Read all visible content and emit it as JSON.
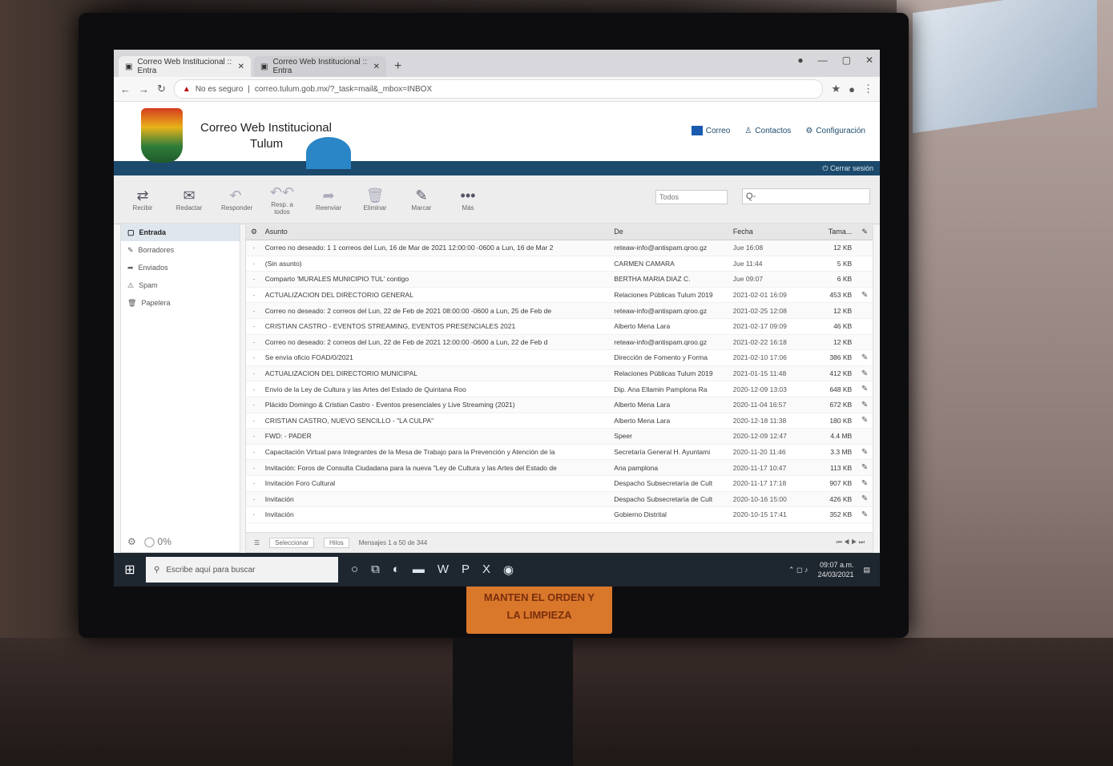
{
  "browser": {
    "tabs": [
      {
        "label": "Correo Web Institucional :: Entra"
      },
      {
        "label": "Correo Web Institucional :: Entra"
      }
    ],
    "new_tab": "+",
    "address_warning": "No es seguro",
    "url": "correo.tulum.gob.mx/?_task=mail&_mbox=INBOX"
  },
  "app": {
    "title_line1": "Correo Web Institucional",
    "title_line2": "Tulum",
    "nav": [
      {
        "label": "Correo"
      },
      {
        "label": "Contactos"
      },
      {
        "label": "Configuración"
      }
    ],
    "logout": "Cerrar sesión"
  },
  "toolbar": {
    "filter_placeholder": "Todos",
    "search_placeholder": "Q-",
    "buttons": [
      {
        "icon": "⇄",
        "label": "Recibir"
      },
      {
        "icon": "✉",
        "label": "Redactar"
      },
      {
        "icon": "↶",
        "label": "Responder"
      },
      {
        "icon": "↶↶",
        "label": "Resp. a todos"
      },
      {
        "icon": "➦",
        "label": "Reenviar"
      },
      {
        "icon": "🗑",
        "label": "Eliminar"
      },
      {
        "icon": "✎",
        "label": "Marcar"
      },
      {
        "icon": "•••",
        "label": "Más"
      }
    ]
  },
  "folders": [
    {
      "icon": "▢",
      "label": "Entrada"
    },
    {
      "icon": "✎",
      "label": "Borradores"
    },
    {
      "icon": "➦",
      "label": "Enviados"
    },
    {
      "icon": "⚠",
      "label": "Spam"
    },
    {
      "icon": "🗑",
      "label": "Papelera"
    }
  ],
  "sidebar_footer": {
    "quota": "0%"
  },
  "columns": {
    "subject": "Asunto",
    "from": "De",
    "date": "Fecha",
    "size": "Tama..."
  },
  "messages": [
    {
      "subject": "Correo no deseado: 1 1 correos del Lun, 16 de Mar de 2021 12:00:00 -0600 a Lun, 16 de Mar 2",
      "from": "reteaw-info@antispam.qroo.gz",
      "date": "Jue 16:08",
      "size": "12 KB",
      "clip": ""
    },
    {
      "subject": "(Sin asunto)",
      "from": "CARMEN CAMARA",
      "date": "Jue 11:44",
      "size": "5 KB",
      "clip": ""
    },
    {
      "subject": "Comparto 'MURALES MUNICIPIO TUL' contigo",
      "from": "BERTHA MARIA DIAZ C.",
      "date": "Jue 09:07",
      "size": "6 KB",
      "clip": ""
    },
    {
      "subject": "ACTUALIZACION DEL DIRECTORIO GENERAL",
      "from": "Relaciones Públicas Tulum 2019",
      "date": "2021-02-01 16:09",
      "size": "453 KB",
      "clip": "✎"
    },
    {
      "subject": "Correo no deseado: 2 correos del Lun, 22 de Feb de 2021 08:00:00 -0600 a Lun, 25 de Feb de",
      "from": "reteaw-info@antispam.qroo.gz",
      "date": "2021-02-25 12:08",
      "size": "12 KB",
      "clip": ""
    },
    {
      "subject": "CRISTIAN CASTRO - EVENTOS STREAMING, EVENTOS PRESENCIALES 2021",
      "from": "Alberto Mena Lara",
      "date": "2021-02-17 09:09",
      "size": "46 KB",
      "clip": ""
    },
    {
      "subject": "Correo no deseado: 2 correos del Lun, 22 de Feb de 2021 12:00:00 -0600 a Lun, 22 de Feb d",
      "from": "reteaw-info@antispam.qroo.gz",
      "date": "2021-02-22 16:18",
      "size": "12 KB",
      "clip": ""
    },
    {
      "subject": "Se envía oficio FOAD/0/2021",
      "from": "Dirección de Fomento y Forma",
      "date": "2021-02-10 17:06",
      "size": "386 KB",
      "clip": "✎"
    },
    {
      "subject": "ACTUALIZACION DEL DIRECTORIO MUNICIPAL",
      "from": "Relaciones Públicas Tulum 2019",
      "date": "2021-01-15 11:48",
      "size": "412 KB",
      "clip": "✎"
    },
    {
      "subject": "Envío de la Ley de Cultura y las Artes del Estado de Quintana Roo",
      "from": "Dip. Ana Ellamin Pamplona Ra",
      "date": "2020-12-09 13:03",
      "size": "648 KB",
      "clip": "✎"
    },
    {
      "subject": "Plácido Domingo & Cristian Castro - Eventos presenciales y Live Streaming (2021)",
      "from": "Alberto Mena Lara",
      "date": "2020-11-04 16:57",
      "size": "672 KB",
      "clip": "✎"
    },
    {
      "subject": "CRISTIAN CASTRO, NUEVO SENCILLO - \"LA CULPA\"",
      "from": "Alberto Mena Lara",
      "date": "2020-12-18 11:38",
      "size": "180 KB",
      "clip": "✎"
    },
    {
      "subject": "FWD: - PADER",
      "from": "Speer",
      "date": "2020-12-09 12:47",
      "size": "4.4 MB",
      "clip": ""
    },
    {
      "subject": "Capacitación Virtual para Integrantes de la Mesa de Trabajo para la Prevención y Atención de la",
      "from": "Secretaría General H. Ayuntami",
      "date": "2020-11-20 11:46",
      "size": "3.3 MB",
      "clip": "✎"
    },
    {
      "subject": "Invitación: Foros de Consulta Ciudadana para la nueva \"Ley de Cultura y las Artes del Estado de",
      "from": "Ana pamplona",
      "date": "2020-11-17 10:47",
      "size": "113 KB",
      "clip": "✎"
    },
    {
      "subject": "Invitación Foro Cultural",
      "from": "Despacho Subsecretaría de Cult",
      "date": "2020-11-17 17:18",
      "size": "907 KB",
      "clip": "✎"
    },
    {
      "subject": "Invitación",
      "from": "Despacho Subsecretaría de Cult",
      "date": "2020-10-16 15:00",
      "size": "426 KB",
      "clip": "✎"
    },
    {
      "subject": "Invitación",
      "from": "Gobierno Distrital",
      "date": "2020-10-15 17:41",
      "size": "352 KB",
      "clip": "✎"
    }
  ],
  "list_footer": {
    "select_label": "Seleccionar",
    "threads_label": "Hilos",
    "count_text": "Mensajes 1 a 50 de 344"
  },
  "taskbar": {
    "search_placeholder": "Escribe aquí para buscar",
    "time": "09:07 a.m.",
    "date": "24/03/2021"
  },
  "sticker": {
    "line1": "MANTEN EL ORDEN Y",
    "line2": "LA LIMPIEZA"
  }
}
